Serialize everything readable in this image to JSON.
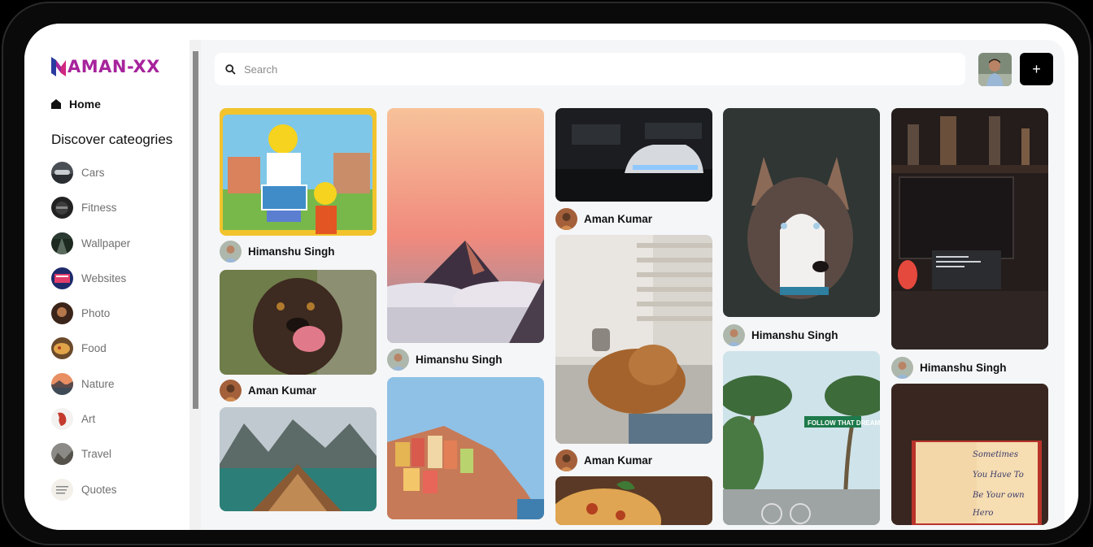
{
  "brand": {
    "name": "AMAN-XX",
    "color": "#a7239c",
    "accent": "#2b3a9e"
  },
  "nav": {
    "home_label": "Home",
    "home_icon": "home-icon"
  },
  "categories": {
    "heading": "Discover cateogries",
    "items": [
      {
        "label": "Cars"
      },
      {
        "label": "Fitness"
      },
      {
        "label": "Wallpaper"
      },
      {
        "label": "Websites"
      },
      {
        "label": "Photo"
      },
      {
        "label": "Food"
      },
      {
        "label": "Nature"
      },
      {
        "label": "Art"
      },
      {
        "label": "Travel"
      },
      {
        "label": "Quotes"
      }
    ]
  },
  "search": {
    "placeholder": "Search",
    "icon": "search-icon"
  },
  "header": {
    "add_label": "+"
  },
  "pins": [
    {
      "id": "simpsons",
      "author": "Himanshu Singh"
    },
    {
      "id": "dog",
      "author": "Aman Kumar"
    },
    {
      "id": "lake",
      "author": ""
    },
    {
      "id": "mountain",
      "author": "Himanshu Singh"
    },
    {
      "id": "cliff-town",
      "author": ""
    },
    {
      "id": "car",
      "author": "Aman Kumar"
    },
    {
      "id": "cat",
      "author": "Aman Kumar"
    },
    {
      "id": "pizza",
      "author": ""
    },
    {
      "id": "husky",
      "author": "Himanshu Singh"
    },
    {
      "id": "palms",
      "author": ""
    },
    {
      "id": "desk",
      "author": "Himanshu Singh"
    },
    {
      "id": "notebook",
      "author": ""
    }
  ],
  "notebook_text": [
    "Sometimes",
    "You Have To",
    "Be Your own",
    "Hero"
  ],
  "street_sign": "FOLLOW THAT DREAM"
}
